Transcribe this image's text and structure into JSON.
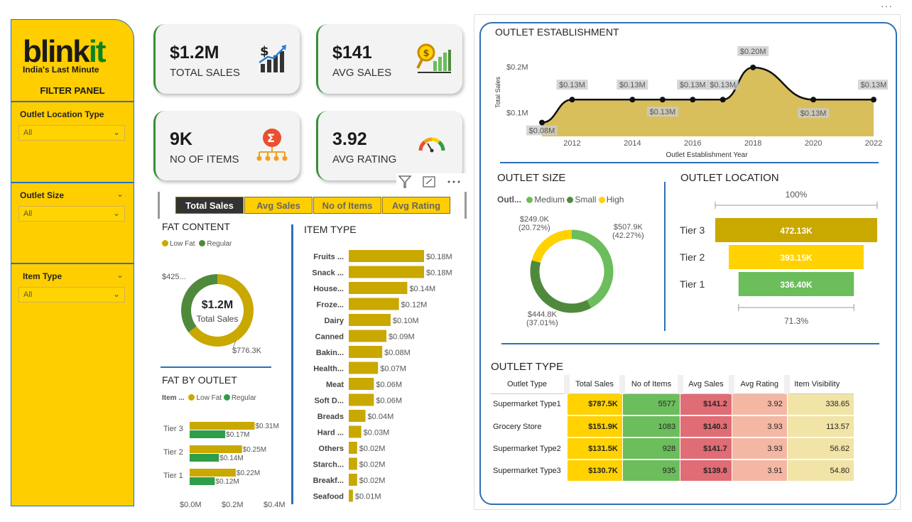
{
  "brand": {
    "name_a": "blink",
    "name_b": "it",
    "tagline": "India's Last Minute"
  },
  "filter_panel": {
    "title": "FILTER PANEL",
    "filters": [
      {
        "label": "Outlet Location Type",
        "value": "All"
      },
      {
        "label": "Outlet Size",
        "value": "All"
      },
      {
        "label": "Item Type",
        "value": "All"
      }
    ]
  },
  "kpis": [
    {
      "value": "$1.2M",
      "label": "TOTAL SALES",
      "icon": "sales-chart-icon"
    },
    {
      "value": "$141",
      "label": "AVG SALES",
      "icon": "dollar-magnifier-icon"
    },
    {
      "value": "9K",
      "label": "NO OF ITEMS",
      "icon": "sigma-network-icon"
    },
    {
      "value": "3.92",
      "label": "AVG RATING",
      "icon": "gauge-icon"
    }
  ],
  "metric_buttons": [
    "Total Sales",
    "Avg Sales",
    "No of Items",
    "Avg Rating"
  ],
  "colors": {
    "brand_yellow": "#ffce00",
    "low_fat": "#c9a800",
    "regular": "#2e9e48",
    "medium": "#6cbd5c",
    "small": "#4f8a3c",
    "high": "#ffd200",
    "item_bar": "#c9a800",
    "establishment_fill": "#d4b84a"
  },
  "chart_data": [
    {
      "id": "fat_content",
      "type": "pie",
      "title": "FAT CONTENT",
      "legend": [
        "Low Fat",
        "Regular"
      ],
      "center_value": "$1.2M",
      "center_label": "Total Sales",
      "slices": [
        {
          "name": "Low Fat",
          "value": 776.3,
          "label": "$776.3K"
        },
        {
          "name": "Regular",
          "value": 425.4,
          "label": "$425..."
        }
      ]
    },
    {
      "id": "fat_by_outlet",
      "type": "bar",
      "title": "FAT BY OUTLET",
      "legend_title": "Item ...",
      "categories": [
        "Tier 3",
        "Tier 2",
        "Tier 1"
      ],
      "series": [
        {
          "name": "Low Fat",
          "values": [
            0.31,
            0.25,
            0.22
          ],
          "labels": [
            "$0.31M",
            "$0.25M",
            "$0.22M"
          ]
        },
        {
          "name": "Regular",
          "values": [
            0.17,
            0.14,
            0.12
          ],
          "labels": [
            "$0.17M",
            "$0.14M",
            "$0.12M"
          ]
        }
      ],
      "xlim": [
        0,
        0.4
      ],
      "xticks": [
        "$0.0M",
        "$0.2M",
        "$0.4M"
      ]
    },
    {
      "id": "item_type",
      "type": "bar",
      "title": "ITEM TYPE",
      "categories": [
        "Fruits ...",
        "Snack ...",
        "House...",
        "Froze...",
        "Dairy",
        "Canned",
        "Bakin...",
        "Health...",
        "Meat",
        "Soft D...",
        "Breads",
        "Hard ...",
        "Others",
        "Starch...",
        "Breakf...",
        "Seafood"
      ],
      "values": [
        0.18,
        0.18,
        0.14,
        0.12,
        0.1,
        0.09,
        0.08,
        0.07,
        0.06,
        0.06,
        0.04,
        0.03,
        0.02,
        0.02,
        0.02,
        0.01
      ],
      "labels": [
        "$0.18M",
        "$0.18M",
        "$0.14M",
        "$0.12M",
        "$0.10M",
        "$0.09M",
        "$0.08M",
        "$0.07M",
        "$0.06M",
        "$0.06M",
        "$0.04M",
        "$0.03M",
        "$0.02M",
        "$0.02M",
        "$0.02M",
        "$0.01M"
      ]
    },
    {
      "id": "outlet_establishment",
      "type": "area",
      "title": "OUTLET ESTABLISHMENT",
      "xlabel": "Outlet Establishment Year",
      "ylabel": "Total Sales",
      "x": [
        2011,
        2012,
        2014,
        2015,
        2016,
        2017,
        2018,
        2020,
        2022
      ],
      "y": [
        0.08,
        0.13,
        0.13,
        0.13,
        0.13,
        0.13,
        0.2,
        0.13,
        0.13
      ],
      "point_labels": [
        "$0.08M",
        "$0.13M",
        "$0.13M",
        "$0.13M",
        "$0.13M",
        "$0.13M",
        "$0.20M",
        "$0.13M",
        "$0.13M"
      ],
      "xticks": [
        "2012",
        "2014",
        "2016",
        "2018",
        "2020",
        "2022"
      ],
      "yticks": [
        "$0.1M",
        "$0.2M"
      ]
    },
    {
      "id": "outlet_size",
      "type": "pie",
      "title": "OUTLET SIZE",
      "legend_title": "Outl...",
      "legend": [
        "Medium",
        "Small",
        "High"
      ],
      "slices": [
        {
          "name": "Medium",
          "value": 507.9,
          "label": "$507.9K",
          "pct": "(42.27%)"
        },
        {
          "name": "Small",
          "value": 444.8,
          "label": "$444.8K",
          "pct": "(37.01%)"
        },
        {
          "name": "High",
          "value": 249.0,
          "label": "$249.0K",
          "pct": "(20.72%)"
        }
      ]
    },
    {
      "id": "outlet_location",
      "type": "bar",
      "title": "OUTLET LOCATION",
      "top_label": "100%",
      "bottom_label": "71.3%",
      "categories": [
        "Tier 3",
        "Tier 2",
        "Tier 1"
      ],
      "values": [
        472.13,
        393.15,
        336.4
      ],
      "labels": [
        "472.13K",
        "393.15K",
        "336.40K"
      ]
    },
    {
      "id": "outlet_type",
      "type": "table",
      "title": "OUTLET TYPE",
      "columns": [
        "Outlet Type",
        "Total Sales",
        "No of Items",
        "Avg Sales",
        "Avg Rating",
        "Item Visibility"
      ],
      "rows": [
        [
          "Supermarket Type1",
          "$787.5K",
          "5577",
          "$141.2",
          "3.92",
          "338.65"
        ],
        [
          "Grocery Store",
          "$151.9K",
          "1083",
          "$140.3",
          "3.93",
          "113.57"
        ],
        [
          "Supermarket Type2",
          "$131.5K",
          "928",
          "$141.7",
          "3.93",
          "56.62"
        ],
        [
          "Supermarket Type3",
          "$130.7K",
          "935",
          "$139.8",
          "3.91",
          "54.80"
        ]
      ]
    }
  ]
}
